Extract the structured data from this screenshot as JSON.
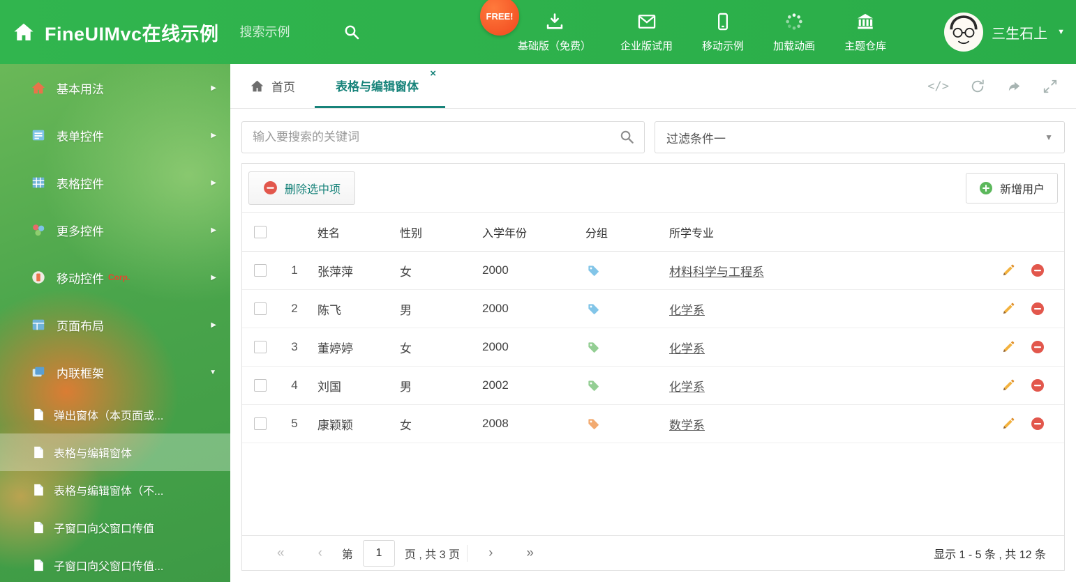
{
  "colors": {
    "header_green": "#2eb14c",
    "accent_teal": "#17837a",
    "danger_red": "#e2574c",
    "success_green": "#5cb85c"
  },
  "icons": {
    "close": "×",
    "caret_down": "▼",
    "arrow_right": "▶",
    "arrow_down": "▼",
    "code": "</>",
    "pg_first": "«",
    "pg_prev": "‹",
    "pg_next": "›",
    "pg_last": "»"
  },
  "header": {
    "title": "FineUIMvc在线示例",
    "search_placeholder": "搜索示例",
    "free_badge": "FREE!",
    "nav": [
      {
        "label": "基础版（免费）",
        "icon": "download-icon"
      },
      {
        "label": "企业版试用",
        "icon": "mail-icon"
      },
      {
        "label": "移动示例",
        "icon": "mobile-icon"
      },
      {
        "label": "加载动画",
        "icon": "spinner-icon"
      },
      {
        "label": "主题仓库",
        "icon": "bank-icon"
      }
    ],
    "user_name": "三生石上"
  },
  "sidebar": {
    "items": [
      {
        "label": "基本用法",
        "icon": "home-icon"
      },
      {
        "label": "表单控件",
        "icon": "form-icon"
      },
      {
        "label": "表格控件",
        "icon": "grid-icon"
      },
      {
        "label": "更多控件",
        "icon": "more-icon"
      },
      {
        "label": "移动控件",
        "icon": "mobile-corp-icon",
        "badge": "Corp."
      },
      {
        "label": "页面布局",
        "icon": "layout-icon"
      },
      {
        "label": "内联框架",
        "icon": "frame-icon",
        "expanded": true
      }
    ],
    "subitems": [
      {
        "label": "弹出窗体（本页面或..."
      },
      {
        "label": "表格与编辑窗体",
        "active": true
      },
      {
        "label": "表格与编辑窗体（不..."
      },
      {
        "label": "子窗口向父窗口传值"
      },
      {
        "label": "子窗口向父窗口传值..."
      }
    ]
  },
  "tabs": {
    "home_label": "首页",
    "active_label": "表格与编辑窗体"
  },
  "filter_bar": {
    "search_placeholder": "输入要搜索的关键词",
    "filter_selected": "过滤条件一"
  },
  "toolbar": {
    "delete_label": "删除选中项",
    "add_label": "新增用户"
  },
  "table": {
    "columns": {
      "name": "姓名",
      "gender": "性别",
      "year": "入学年份",
      "group": "分组",
      "major": "所学专业"
    },
    "rows": [
      {
        "num": "1",
        "name": "张萍萍",
        "gender": "女",
        "year": "2000",
        "tag_color": "#82c5e8",
        "major": "材料科学与工程系"
      },
      {
        "num": "2",
        "name": "陈飞",
        "gender": "男",
        "year": "2000",
        "tag_color": "#82c5e8",
        "major": "化学系"
      },
      {
        "num": "3",
        "name": "董婷婷",
        "gender": "女",
        "year": "2000",
        "tag_color": "#93ce93",
        "major": "化学系"
      },
      {
        "num": "4",
        "name": "刘国",
        "gender": "男",
        "year": "2002",
        "tag_color": "#93ce93",
        "major": "化学系"
      },
      {
        "num": "5",
        "name": "康颖颖",
        "gender": "女",
        "year": "2008",
        "tag_color": "#f2aa70",
        "major": "数学系"
      }
    ]
  },
  "pagination": {
    "page_prefix": "第",
    "page_value": "1",
    "page_suffix": "页 , 共 3 页",
    "summary": "显示 1 - 5 条 , 共 12 条"
  }
}
